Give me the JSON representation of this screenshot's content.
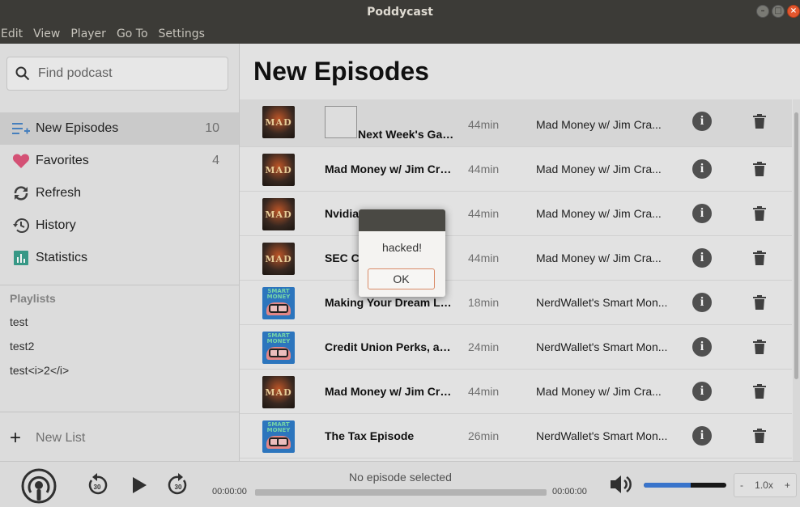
{
  "window": {
    "title": "Poddycast"
  },
  "menubar": [
    "Edit",
    "View",
    "Player",
    "Go To",
    "Settings"
  ],
  "search": {
    "placeholder": "Find podcast"
  },
  "nav": [
    {
      "label": "New Episodes",
      "count": "10",
      "icon": "new-episodes-icon",
      "active": true
    },
    {
      "label": "Favorites",
      "count": "4",
      "icon": "heart-icon"
    },
    {
      "label": "Refresh",
      "count": "",
      "icon": "refresh-icon"
    },
    {
      "label": "History",
      "count": "",
      "icon": "history-icon"
    },
    {
      "label": "Statistics",
      "count": "",
      "icon": "statistics-icon"
    }
  ],
  "playlists": {
    "label": "Playlists",
    "items": [
      "test",
      "test2",
      "test<i>2</i>"
    ],
    "new_list_label": "New List"
  },
  "main": {
    "title": "New Episodes"
  },
  "episodes": [
    {
      "title": "Next Week's Gam...",
      "duration": "44min",
      "podcast": "Mad Money w/ Jim Cra...",
      "art": "mad"
    },
    {
      "title": "Mad Money w/ Jim Cra...",
      "duration": "44min",
      "podcast": "Mad Money w/ Jim Cra...",
      "art": "mad"
    },
    {
      "title": "Nvidia ...D,...",
      "duration": "44min",
      "podcast": "Mad Money w/ Jim Cra...",
      "art": "mad"
    },
    {
      "title": "SEC Cl...",
      "duration": "44min",
      "podcast": "Mad Money w/ Jim Cra...",
      "art": "mad"
    },
    {
      "title": "Making Your Dream Life",
      "duration": "18min",
      "podcast": "NerdWallet's Smart Mon...",
      "art": "nerd"
    },
    {
      "title": "Credit Union Perks, and ...",
      "duration": "24min",
      "podcast": "NerdWallet's Smart Mon...",
      "art": "nerd"
    },
    {
      "title": "Mad Money w/ Jim Cra...",
      "duration": "44min",
      "podcast": "Mad Money w/ Jim Cra...",
      "art": "mad"
    },
    {
      "title": "The Tax Episode",
      "duration": "26min",
      "podcast": "NerdWallet's Smart Mon...",
      "art": "nerd"
    }
  ],
  "player": {
    "now_playing": "No episode selected",
    "time_start": "00:00:00",
    "time_end": "00:00:00",
    "rewind_label": "30",
    "forward_label": "30",
    "volume_level": 0.57,
    "speed_minus": "-",
    "speed": "1.0x",
    "speed_plus": "+"
  },
  "dialog": {
    "message": "hacked!",
    "ok_label": "OK"
  },
  "colors": {
    "accent": "#3d7bd6",
    "titlebar": "#3c3b37",
    "favorite": "#e0567c",
    "new_icon": "#4a86c8",
    "stats_icon": "#3aa18e"
  }
}
